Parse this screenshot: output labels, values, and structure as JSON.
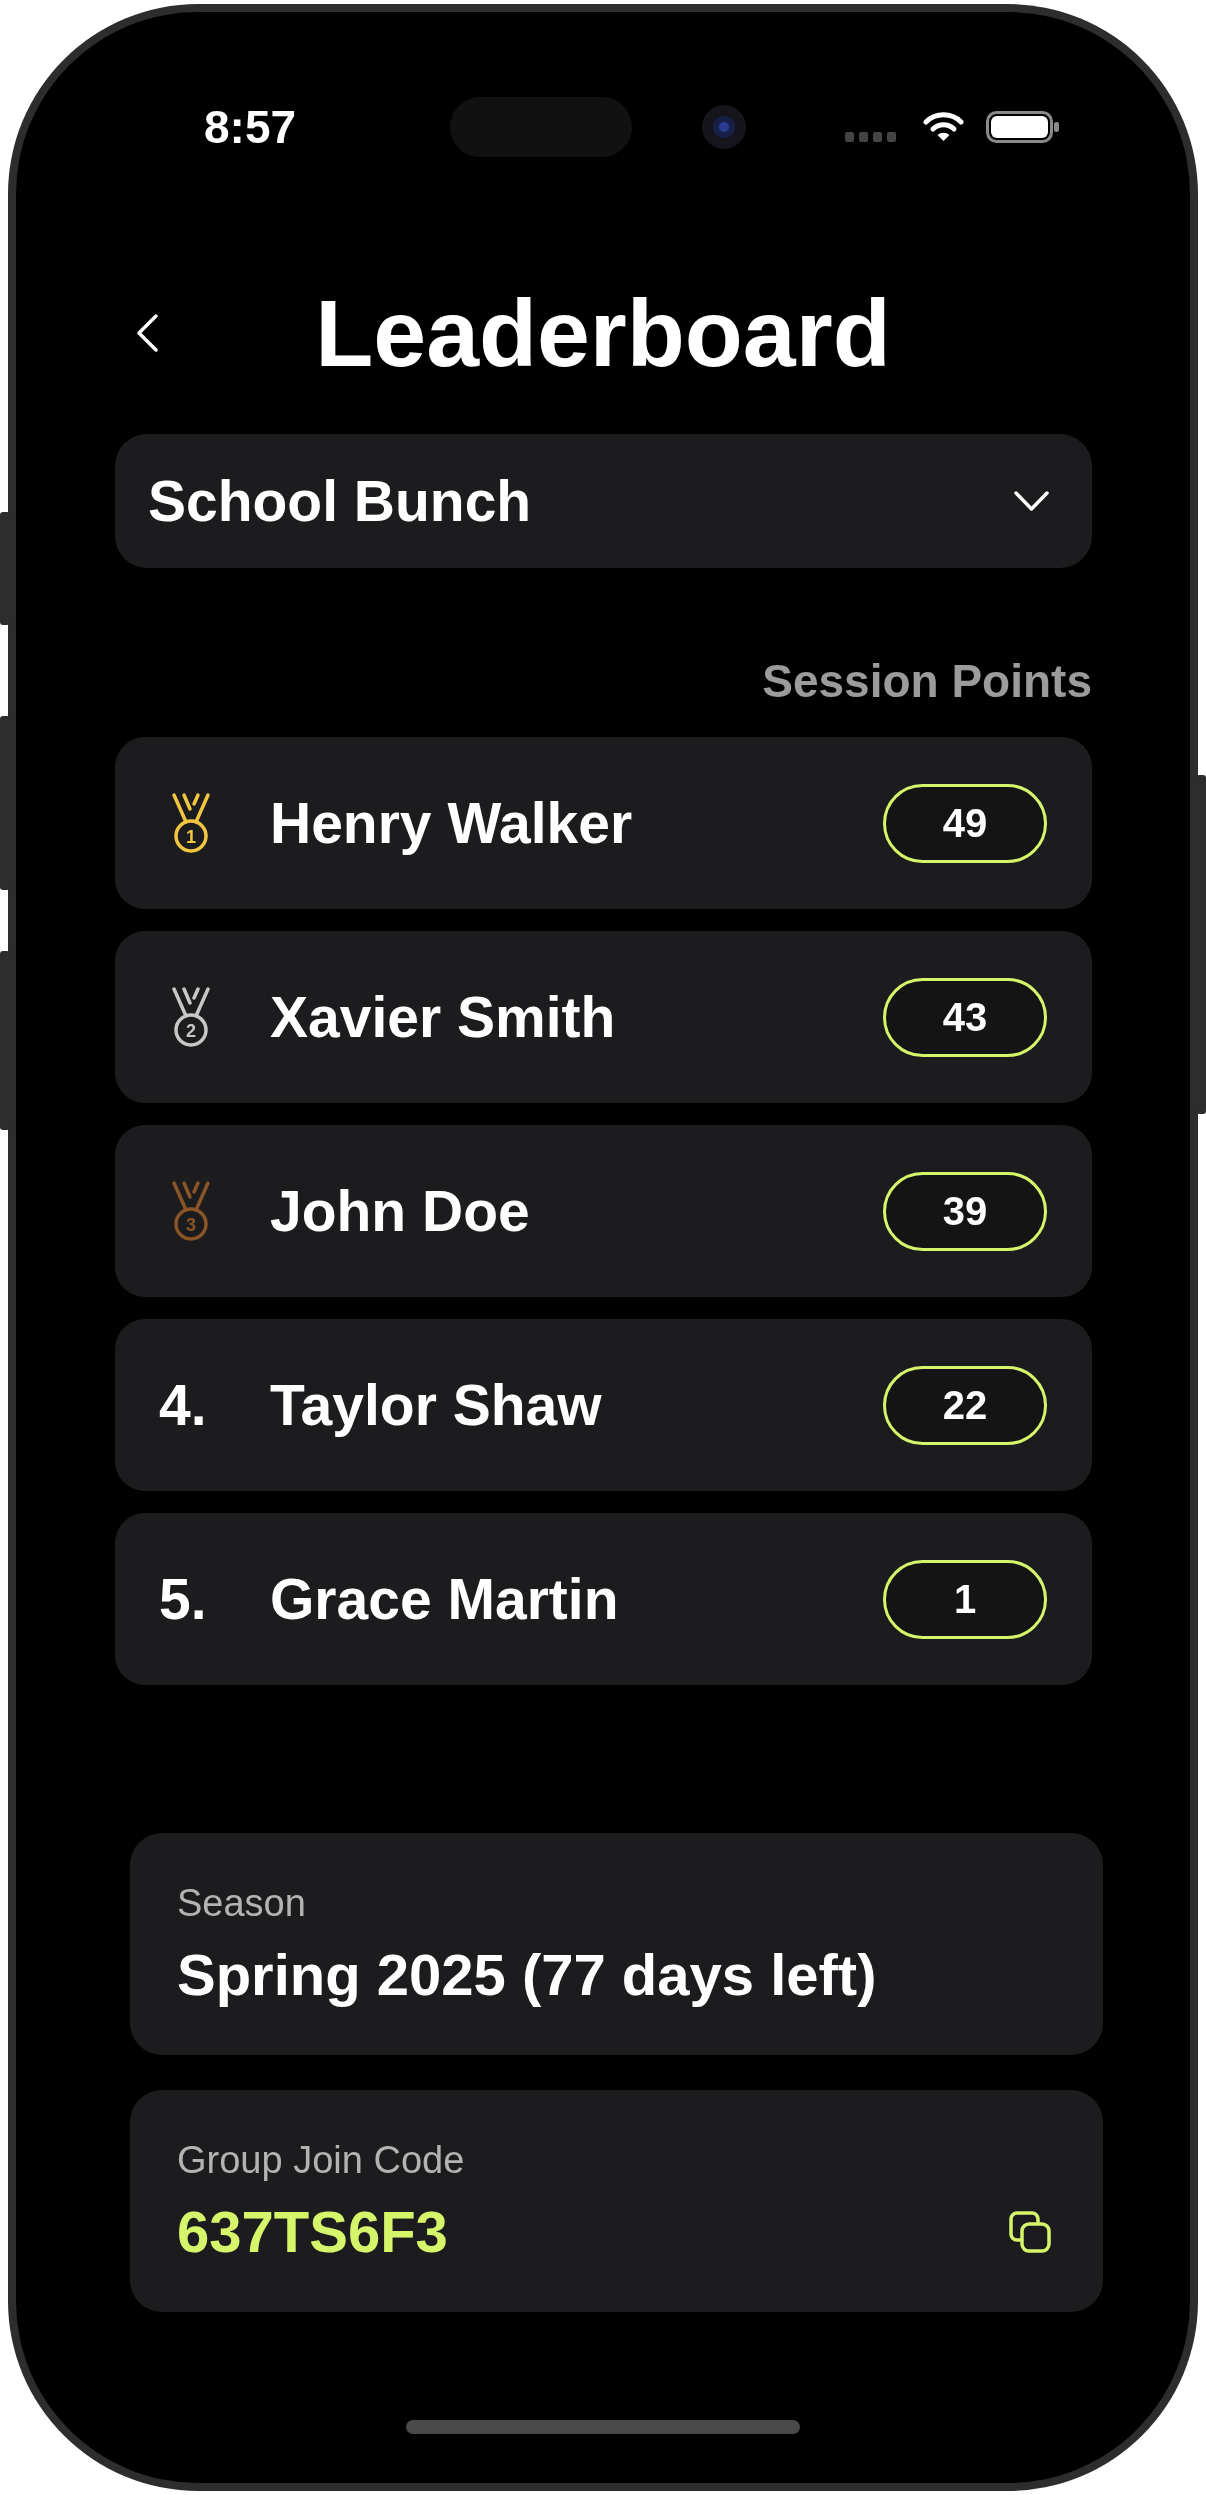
{
  "status_bar": {
    "time": "8:57"
  },
  "header": {
    "title": "Leaderboard"
  },
  "group_selector": {
    "value": "School Bunch"
  },
  "leaderboard": {
    "column_heading": "Session Points",
    "rows": [
      {
        "kind": "medal",
        "rank": "1",
        "color": "#f2c641",
        "name": "Henry Walker",
        "points": "49"
      },
      {
        "kind": "medal",
        "rank": "2",
        "color": "#c7c7c7",
        "name": "Xavier Smith",
        "points": "43"
      },
      {
        "kind": "medal",
        "rank": "3",
        "color": "#8a5426",
        "name": "John Doe",
        "points": "39"
      },
      {
        "kind": "number",
        "rank": "4.",
        "name": "Taylor Shaw",
        "points": "22"
      },
      {
        "kind": "number",
        "rank": "5.",
        "name": "Grace Martin",
        "points": "1"
      }
    ]
  },
  "season": {
    "label": "Season",
    "value": "Spring 2025 (77 days left)"
  },
  "join_code": {
    "label": "Group Join Code",
    "code": "637TS6F3"
  }
}
